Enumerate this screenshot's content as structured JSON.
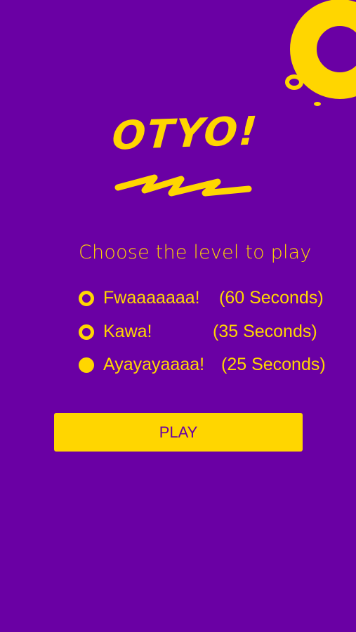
{
  "app": {
    "logo_text": "OTYO!"
  },
  "colors": {
    "background": "#6a00a4",
    "accent": "#ffd600"
  },
  "level_select": {
    "prompt": "Choose the level to play",
    "options": [
      {
        "name": "Fwaaaaaaa!",
        "time": "(60 Seconds)",
        "selected": false
      },
      {
        "name": "Kawa!",
        "time": "(35 Seconds)",
        "selected": false
      },
      {
        "name": "Ayayayaaaa!",
        "time": "(25 Seconds)",
        "selected": true
      }
    ]
  },
  "play_button": {
    "label": "PLAY"
  }
}
